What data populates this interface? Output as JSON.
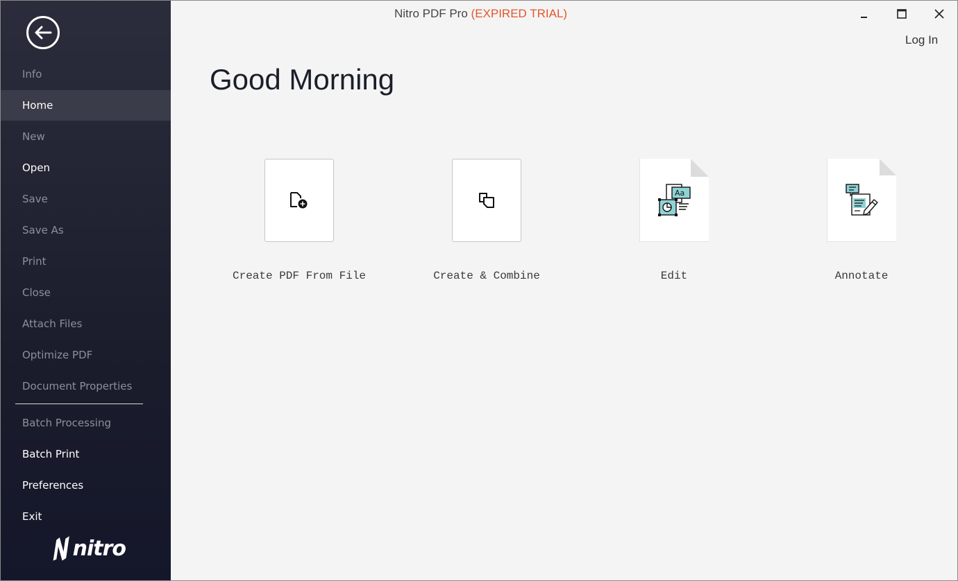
{
  "window": {
    "title_app": "Nitro PDF Pro",
    "title_status": "(EXPIRED TRIAL)",
    "minimize_icon": "minimize-icon",
    "maximize_icon": "maximize-icon",
    "close_icon": "close-icon"
  },
  "sidebar": {
    "back_icon": "arrow-left-circle-icon",
    "items": [
      {
        "label": "Info",
        "state": "disabled"
      },
      {
        "label": "Home",
        "state": "active"
      },
      {
        "label": "New",
        "state": "disabled"
      },
      {
        "label": "Open",
        "state": "enabled"
      },
      {
        "label": "Save",
        "state": "disabled"
      },
      {
        "label": "Save As",
        "state": "disabled"
      },
      {
        "label": "Print",
        "state": "disabled"
      },
      {
        "label": "Close",
        "state": "disabled"
      },
      {
        "label": "Attach Files",
        "state": "disabled"
      },
      {
        "label": "Optimize PDF",
        "state": "disabled"
      },
      {
        "label": "Document Properties",
        "state": "disabled"
      }
    ],
    "items_bottom": [
      {
        "label": "Batch Processing",
        "state": "disabled"
      },
      {
        "label": "Batch Print",
        "state": "enabled"
      },
      {
        "label": "Preferences",
        "state": "enabled"
      },
      {
        "label": "Exit",
        "state": "enabled"
      }
    ],
    "logo_text": "nitro"
  },
  "header": {
    "login_label": "Log In",
    "greeting": "Good Morning"
  },
  "actions": [
    {
      "label": "Create PDF From File",
      "icon": "file-add-icon"
    },
    {
      "label": "Create & Combine",
      "icon": "combine-icon"
    },
    {
      "label": "Edit",
      "icon": "edit-document-icon"
    },
    {
      "label": "Annotate",
      "icon": "annotate-document-icon"
    }
  ],
  "colors": {
    "sidebar_bg": "#1b1d2c",
    "active_item_bg": "#3a3c49",
    "expired_text": "#e2562b",
    "content_bg": "#f4f4f4",
    "icon_accent": "#8fd3d6"
  }
}
